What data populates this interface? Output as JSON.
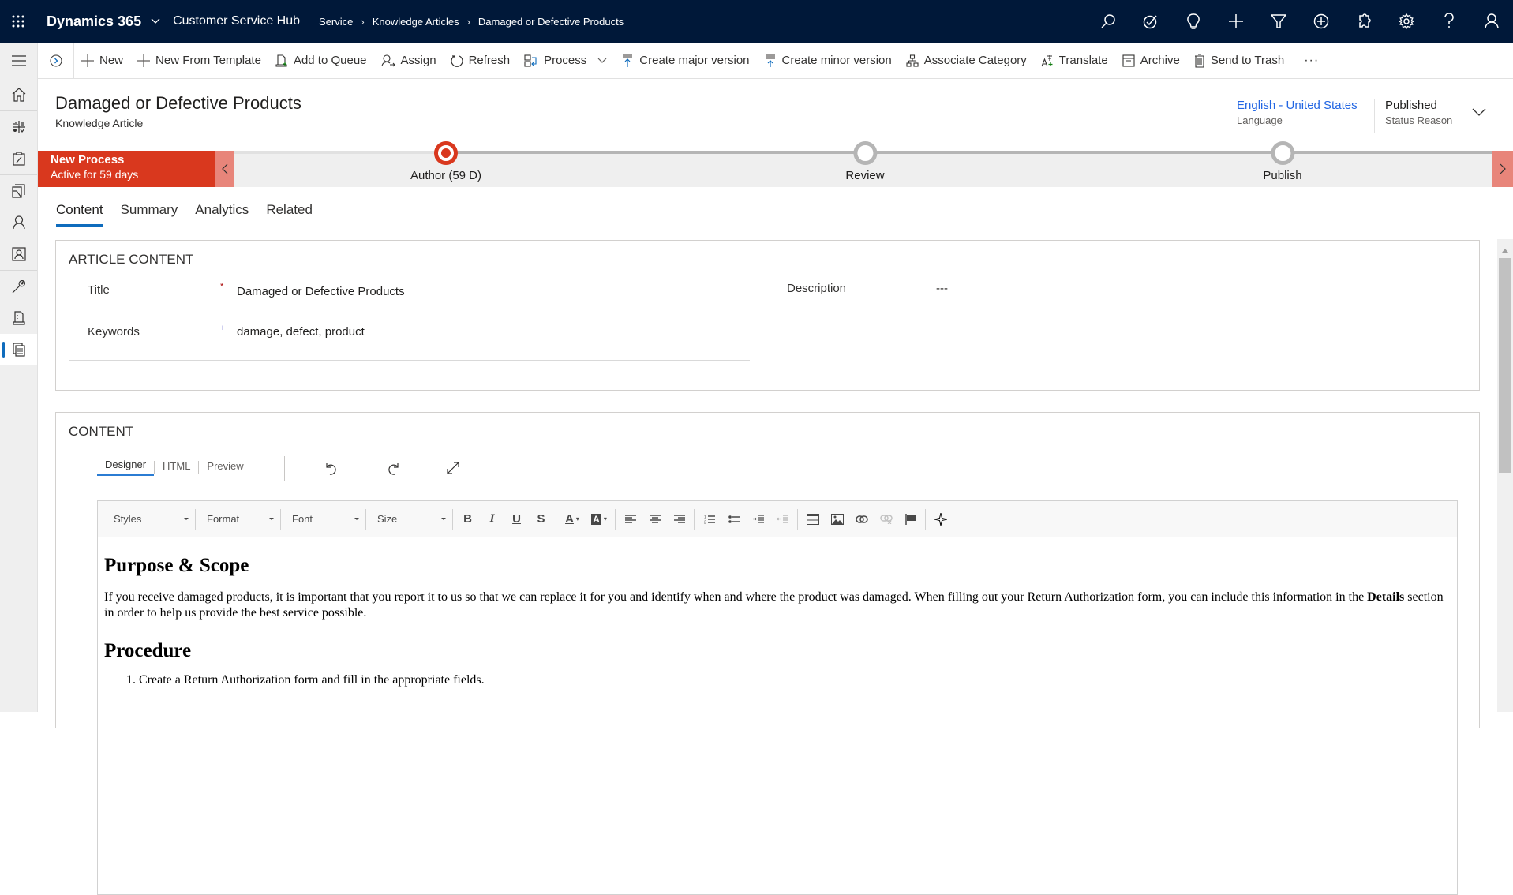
{
  "topbar": {
    "brand": "Dynamics 365",
    "app_name": "Customer Service Hub",
    "breadcrumb": [
      "Service",
      "Knowledge Articles",
      "Damaged or Defective Products"
    ],
    "icons": [
      "search-icon",
      "task-icon",
      "lightbulb-icon",
      "new-icon",
      "filter-icon",
      "add-circle-icon",
      "puzzle-icon",
      "settings-icon",
      "help-icon",
      "user-icon"
    ]
  },
  "sidebar": {
    "items": [
      {
        "name": "home",
        "icon": "home-icon"
      },
      {
        "name": "dashboards",
        "icon": "dashboard-icon"
      },
      {
        "name": "activities",
        "icon": "clipboard-icon"
      },
      {
        "name": "cases",
        "icon": "folder-icon"
      },
      {
        "name": "contacts",
        "icon": "person-icon"
      },
      {
        "name": "accounts",
        "icon": "contact-card-icon"
      },
      {
        "name": "tools",
        "icon": "wrench-icon"
      },
      {
        "name": "queues",
        "icon": "printer-icon"
      },
      {
        "name": "knowledge-articles",
        "icon": "document-icon",
        "active": true
      }
    ]
  },
  "commands": [
    {
      "label": "New",
      "icon": "plus-icon"
    },
    {
      "label": "New From Template",
      "icon": "plus-icon"
    },
    {
      "label": "Add to Queue",
      "icon": "queue-icon"
    },
    {
      "label": "Assign",
      "icon": "assign-icon"
    },
    {
      "label": "Refresh",
      "icon": "refresh-icon"
    },
    {
      "label": "Process",
      "icon": "process-icon"
    },
    {
      "label": "Create major version",
      "icon": "major-version-icon"
    },
    {
      "label": "Create minor version",
      "icon": "minor-version-icon"
    },
    {
      "label": "Associate Category",
      "icon": "category-icon"
    },
    {
      "label": "Translate",
      "icon": "translate-icon"
    },
    {
      "label": "Archive",
      "icon": "archive-icon"
    },
    {
      "label": "Send to Trash",
      "icon": "trash-icon"
    }
  ],
  "more_label": "···",
  "header": {
    "title": "Damaged or Defective Products",
    "entity": "Knowledge Article",
    "language_value": "English - United States",
    "language_label": "Language",
    "status_value": "Published",
    "status_label": "Status Reason"
  },
  "process": {
    "name": "New Process",
    "duration": "Active for 59 days",
    "stages": [
      {
        "label": "Author  (59 D)",
        "active": true
      },
      {
        "label": "Review",
        "active": false
      },
      {
        "label": "Publish",
        "active": false
      }
    ]
  },
  "tabs": [
    {
      "label": "Content",
      "active": true
    },
    {
      "label": "Summary",
      "active": false
    },
    {
      "label": "Analytics",
      "active": false
    },
    {
      "label": "Related",
      "active": false
    }
  ],
  "article_content": {
    "section_title": "ARTICLE CONTENT",
    "fields": [
      {
        "label": "Title",
        "value": "Damaged or Defective Products",
        "required": "*",
        "required_color": "#a80000"
      },
      {
        "label": "Keywords",
        "value": "damage, defect, product",
        "required": "+",
        "required_color": "#0000a8"
      },
      {
        "label": "Description",
        "value": "---"
      }
    ]
  },
  "content": {
    "section_title": "CONTENT",
    "editor_tabs": [
      "Designer",
      "HTML",
      "Preview"
    ],
    "active_editor_tab": "Designer",
    "toolbar_combos": [
      "Styles",
      "Format",
      "Font",
      "Size"
    ],
    "body": {
      "heading1": "Purpose & Scope",
      "para_part1": "If you receive damaged products, it is important that you report it to us so that we can replace it for you and identify when and where the product was damaged. When filling out your Return Authorization form, you can include this information in the ",
      "para_bold": "Details",
      "para_part2": " section in order to help us provide the best service possible.",
      "heading2": "Procedure",
      "steps": [
        "Create a Return Authorization form and fill in the appropriate fields."
      ]
    }
  },
  "colors": {
    "topbar": "#001839",
    "process_active": "#d9381e",
    "accent": "#0f6cbd",
    "link": "#2266e3"
  }
}
